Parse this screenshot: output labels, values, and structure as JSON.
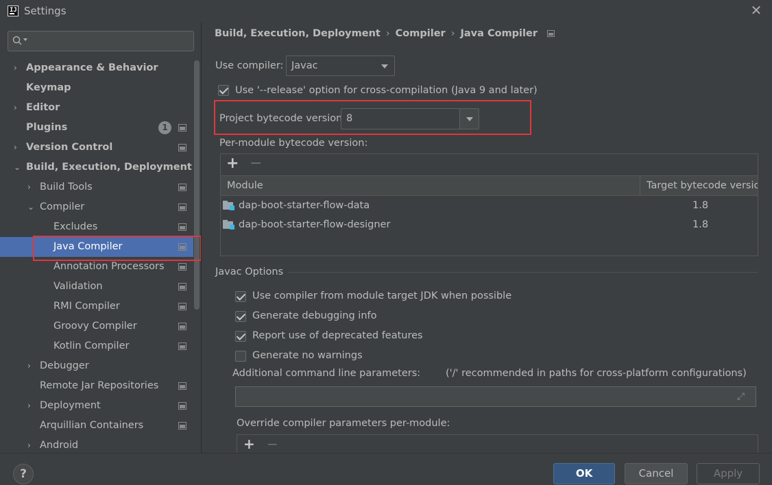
{
  "window": {
    "title": "Settings",
    "close_glyph": "✕",
    "logo_text": "IJ"
  },
  "search": {
    "placeholder": "",
    "value": ""
  },
  "sidebar": {
    "items": [
      {
        "label": "Appearance & Behavior",
        "arrow": "›"
      },
      {
        "label": "Keymap"
      },
      {
        "label": "Editor",
        "arrow": "›"
      },
      {
        "label": "Plugins",
        "badge": "1"
      },
      {
        "label": "Version Control",
        "arrow": "›"
      },
      {
        "label": "Build, Execution, Deployment",
        "arrow": "⌄"
      },
      {
        "label": "Build Tools",
        "arrow": "›"
      },
      {
        "label": "Compiler",
        "arrow": "⌄"
      },
      {
        "label": "Excludes"
      },
      {
        "label": "Java Compiler",
        "selected": true
      },
      {
        "label": "Annotation Processors"
      },
      {
        "label": "Validation"
      },
      {
        "label": "RMI Compiler"
      },
      {
        "label": "Groovy Compiler"
      },
      {
        "label": "Kotlin Compiler"
      },
      {
        "label": "Debugger",
        "arrow": "›"
      },
      {
        "label": "Remote Jar Repositories"
      },
      {
        "label": "Deployment",
        "arrow": "›"
      },
      {
        "label": "Arquillian Containers"
      },
      {
        "label": "Android",
        "arrow": "›"
      }
    ]
  },
  "breadcrumb": {
    "items": [
      "Build, Execution, Deployment",
      "Compiler",
      "Java Compiler"
    ],
    "separator": "›"
  },
  "main": {
    "use_compiler_label": "Use compiler:",
    "use_compiler_value": "Javac",
    "release_option_label": "Use '--release' option for cross-compilation (Java 9 and later)",
    "release_option_checked": true,
    "bytecode_label": "Project bytecode version:",
    "bytecode_value": "8",
    "per_module_label": "Per-module bytecode version:",
    "toolbar": {
      "add": "+",
      "remove": "−"
    },
    "module_table": {
      "headers": [
        "Module",
        "Target bytecode version"
      ],
      "rows": [
        {
          "module": "dap-boot-starter-flow-data",
          "version": "1.8"
        },
        {
          "module": "dap-boot-starter-flow-designer",
          "version": "1.8"
        }
      ]
    },
    "javac_options_title": "Javac Options",
    "javac_options": [
      {
        "label": "Use compiler from module target JDK when possible",
        "checked": true
      },
      {
        "label": "Generate debugging info",
        "checked": true
      },
      {
        "label": "Report use of deprecated features",
        "checked": true
      },
      {
        "label": "Generate no warnings",
        "checked": false
      }
    ],
    "additional_params_label": "Additional command line parameters:",
    "additional_params_hint": "('/' recommended in paths for cross-platform configurations)",
    "additional_params_value": "",
    "expand_glyph": "⤢",
    "override_label": "Override compiler parameters per-module:"
  },
  "footer": {
    "help": "?",
    "ok": "OK",
    "cancel": "Cancel",
    "apply": "Apply"
  },
  "colors": {
    "selection": "#4b6eaf",
    "highlight": "#e0373c",
    "ok_button": "#365880"
  }
}
